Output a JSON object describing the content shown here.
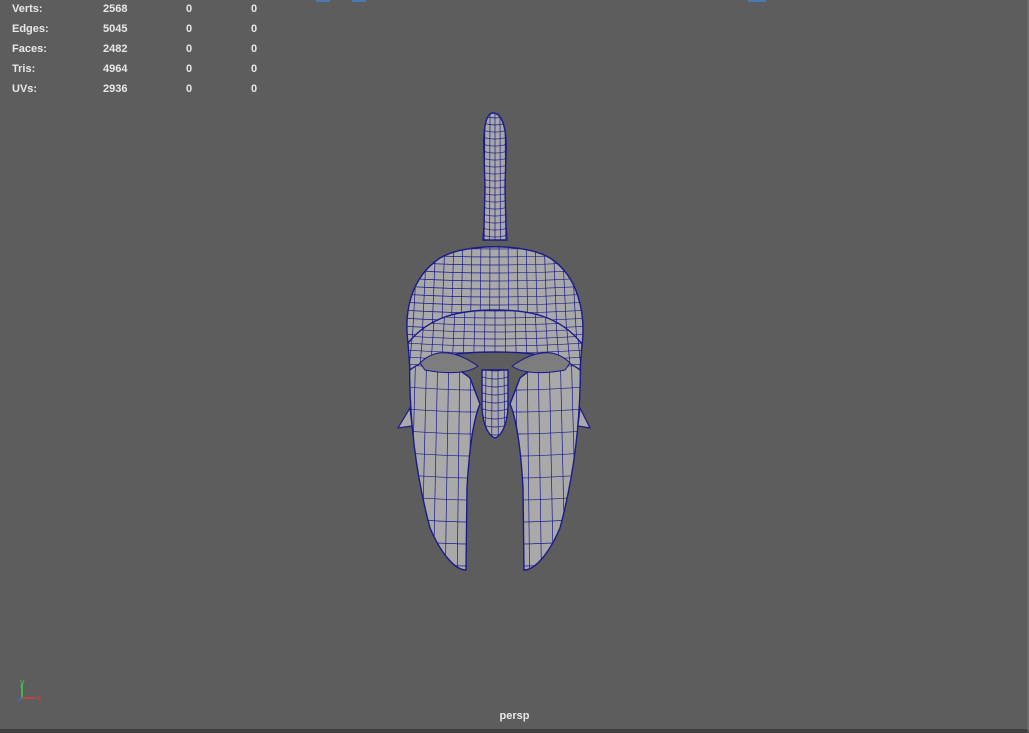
{
  "viewport": {
    "camera_name": "persp",
    "background_color": "#5d5d5d",
    "wireframe_color": "#1a1a8c",
    "shading_color": "#a9a9a9"
  },
  "heads_up_display": {
    "rows": [
      {
        "label": "Verts:",
        "count": "2568",
        "selected": "0",
        "selected_uv": "0"
      },
      {
        "label": "Edges:",
        "count": "5045",
        "selected": "0",
        "selected_uv": "0"
      },
      {
        "label": "Faces:",
        "count": "2482",
        "selected": "0",
        "selected_uv": "0"
      },
      {
        "label": "Tris:",
        "count": "4964",
        "selected": "0",
        "selected_uv": "0"
      },
      {
        "label": "UVs:",
        "count": "2936",
        "selected": "0",
        "selected_uv": "0"
      }
    ]
  },
  "axis_gizmo": {
    "y_label": "y",
    "x_label": "x",
    "y_color": "#3fd13f",
    "x_color": "#d13f3f",
    "z_color": "#3f6fd1"
  }
}
